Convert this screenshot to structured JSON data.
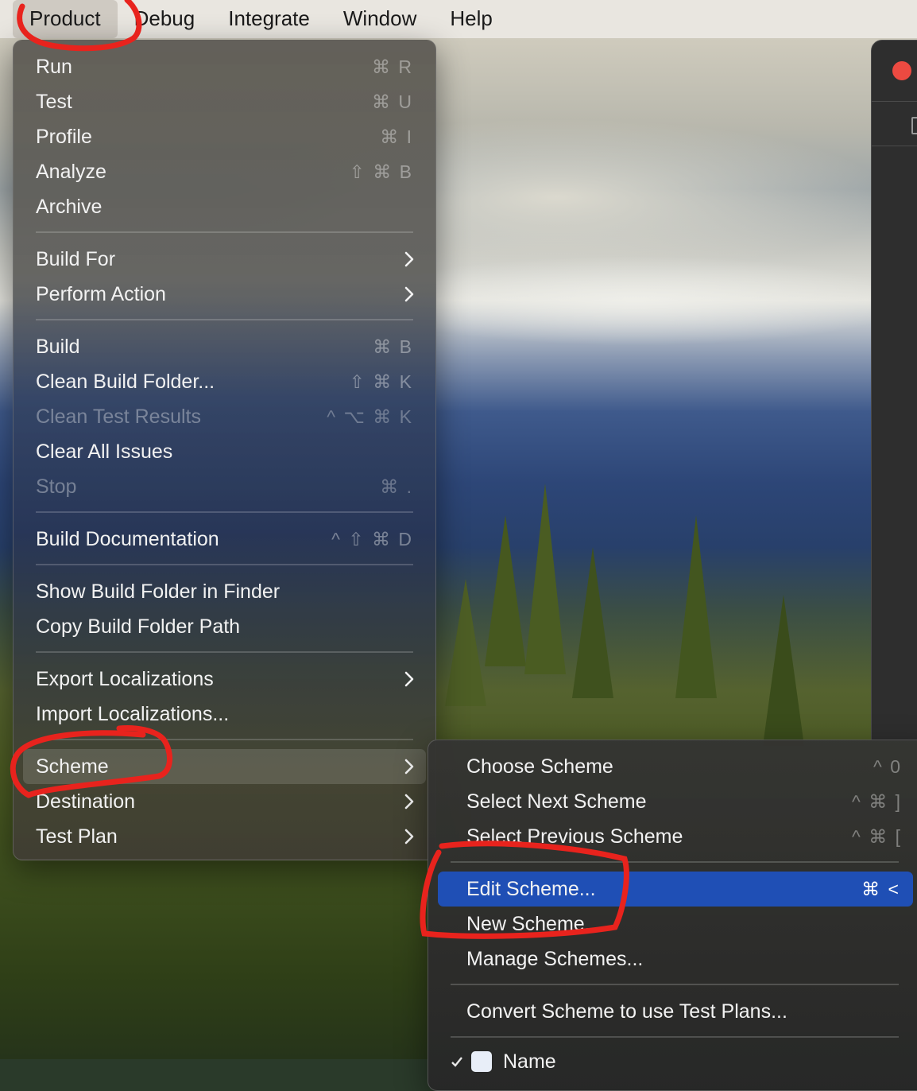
{
  "menubar": {
    "items": [
      {
        "label": "Product",
        "active": true
      },
      {
        "label": "Debug"
      },
      {
        "label": "Integrate"
      },
      {
        "label": "Window"
      },
      {
        "label": "Help"
      }
    ]
  },
  "product_menu": {
    "run": {
      "label": "Run",
      "shortcut": "⌘ R"
    },
    "test": {
      "label": "Test",
      "shortcut": "⌘ U"
    },
    "profile": {
      "label": "Profile",
      "shortcut": "⌘ I"
    },
    "analyze": {
      "label": "Analyze",
      "shortcut": "⇧ ⌘ B"
    },
    "archive": {
      "label": "Archive"
    },
    "build_for": {
      "label": "Build For"
    },
    "perform_action": {
      "label": "Perform Action"
    },
    "build": {
      "label": "Build",
      "shortcut": "⌘ B"
    },
    "clean_build_folder": {
      "label": "Clean Build Folder...",
      "shortcut": "⇧ ⌘ K"
    },
    "clean_test_results": {
      "label": "Clean Test Results",
      "shortcut": "^ ⌥ ⌘ K",
      "enabled": false
    },
    "clear_all_issues": {
      "label": "Clear All Issues"
    },
    "stop": {
      "label": "Stop",
      "shortcut": "⌘ .",
      "enabled": false
    },
    "build_documentation": {
      "label": "Build Documentation",
      "shortcut": "^ ⇧ ⌘ D"
    },
    "show_build_folder": {
      "label": "Show Build Folder in Finder"
    },
    "copy_build_folder_path": {
      "label": "Copy Build Folder Path"
    },
    "export_localizations": {
      "label": "Export Localizations"
    },
    "import_localizations": {
      "label": "Import Localizations..."
    },
    "scheme": {
      "label": "Scheme",
      "highlighted": true
    },
    "destination": {
      "label": "Destination"
    },
    "test_plan": {
      "label": "Test Plan"
    }
  },
  "scheme_menu": {
    "choose_scheme": {
      "label": "Choose Scheme",
      "shortcut": "^ 0"
    },
    "select_next_scheme": {
      "label": "Select Next Scheme",
      "shortcut": "^ ⌘ ]"
    },
    "select_previous_scheme": {
      "label": "Select Previous Scheme",
      "shortcut": "^ ⌘ ["
    },
    "edit_scheme": {
      "label": "Edit Scheme...",
      "shortcut": "⌘ <",
      "highlighted": true
    },
    "new_scheme": {
      "label": "New Scheme..."
    },
    "manage_schemes": {
      "label": "Manage Schemes..."
    },
    "convert_scheme": {
      "label": "Convert Scheme to use Test Plans..."
    },
    "partial_next": {
      "label": "Name"
    }
  },
  "colors": {
    "selection_blue": "#1f4fb5",
    "annotation_red": "#e8231d",
    "close_button": "#ec4a41"
  },
  "icons": [
    "chevron-right-icon",
    "checkmark-icon",
    "app-icon",
    "close-icon"
  ]
}
